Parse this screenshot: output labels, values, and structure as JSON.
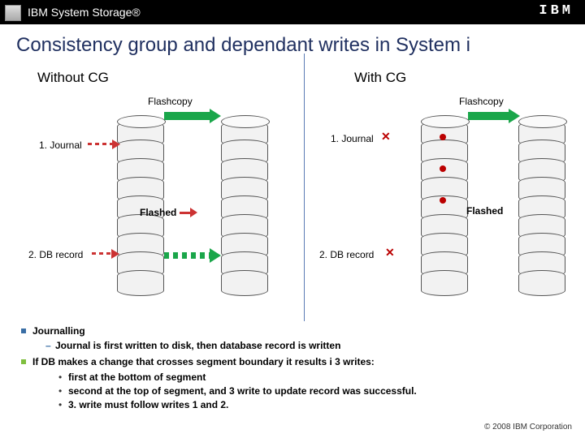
{
  "header": {
    "brand_line": "IBM System Storage®",
    "logo_text": "IBM"
  },
  "title": "Consistency group and dependant writes in System i",
  "left": {
    "heading": "Without CG",
    "flashcopy": "Flashcopy",
    "journal": "1. Journal",
    "flashed": "Flashed",
    "dbrecord": "2. DB record"
  },
  "right": {
    "heading": "With CG",
    "flashcopy": "Flashcopy",
    "journal": "1. Journal",
    "flashed": "Flashed",
    "dbrecord": "2. DB record"
  },
  "bullets": {
    "b1": "Journalling",
    "b1_sub": "Journal is first written to disk, then database record is written",
    "b2": "If DB makes a change that crosses segment boundary it results i 3 writes:",
    "b2_1": "first at the bottom of segment",
    "b2_2": "second at the top of segment, and 3 write to update record was successful.",
    "b2_3": "3. write must follow writes 1 and 2."
  },
  "footer": "© 2008 IBM Corporation"
}
